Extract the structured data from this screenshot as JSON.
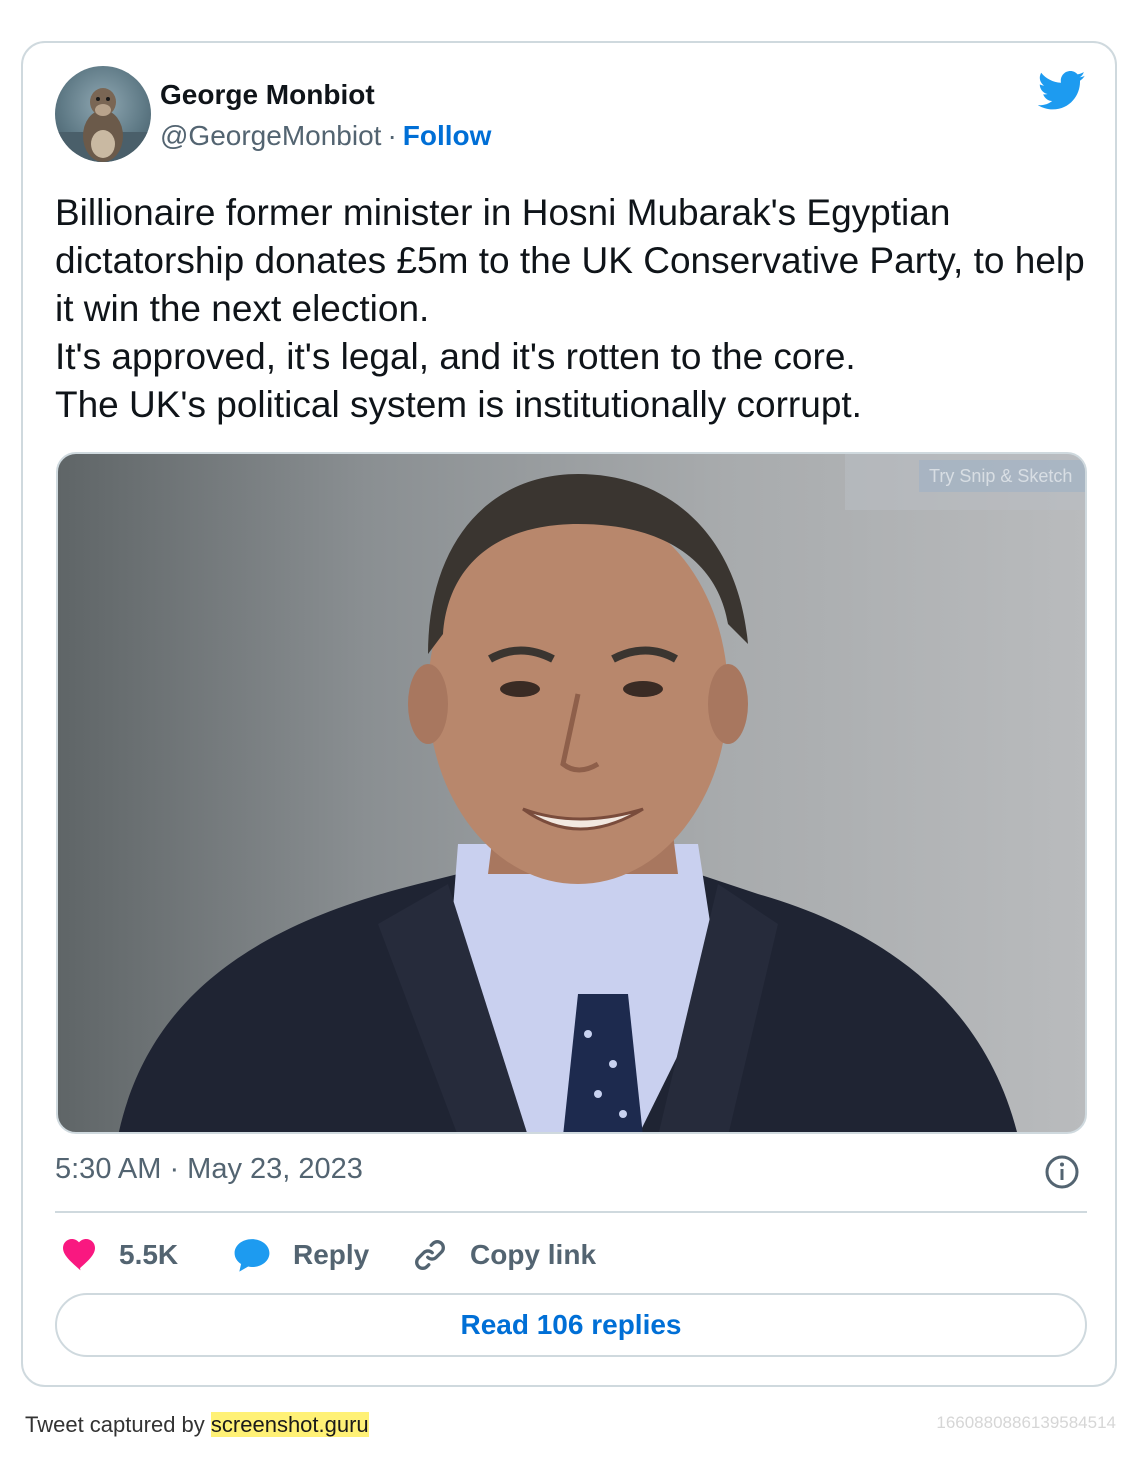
{
  "tweet": {
    "author_name": "George Monbiot",
    "handle": "@GeorgeMonbiot",
    "separator": "·",
    "follow_label": "Follow",
    "text_lines": [
      "Billionaire former minister in Hosni Mubarak's Egyptian dictatorship donates £5m to the UK Conservative Party, to help it win the next election.",
      "It's approved, it's legal, and it's rotten to the core.",
      "The UK's political system is institutionally corrupt."
    ],
    "media_overlay_text": "Try Snip & Sketch",
    "timestamp": "5:30 AM · May 23, 2023",
    "likes_count": "5.5K",
    "reply_label": "Reply",
    "copy_link_label": "Copy link",
    "read_replies_label": "Read 106 replies"
  },
  "footer": {
    "captured_by_prefix": "Tweet captured by",
    "captured_by_link": "screenshot.guru",
    "tweet_id": "1660880886139584514"
  },
  "icons": {
    "brand": "twitter-bird-icon",
    "like": "heart-icon",
    "reply": "speech-bubble-icon",
    "copy": "link-icon",
    "info": "info-icon"
  },
  "colors": {
    "brand_blue": "#1d9bf0",
    "link_blue": "#006fd6",
    "heart_pink": "#f91880",
    "muted_text": "#536471",
    "border": "#cfd9de",
    "highlight": "#fff176"
  }
}
